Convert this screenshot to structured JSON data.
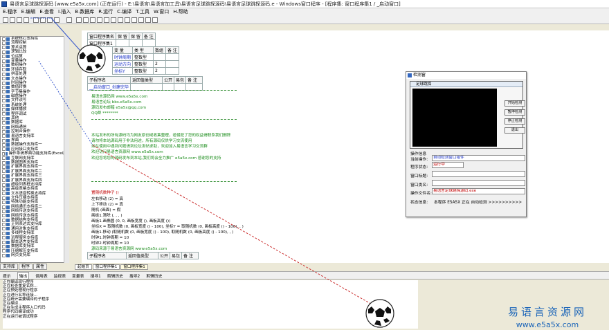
{
  "window": {
    "title": "易语言足球跳探源码 [www.e5a5x.com] (正在运行) - E:\\易语言\\易语言加工具\\易语言足球跳探源码\\易语言足球跳探源码.e - Windows窗口程序 - [程序集: 窗口程序集1 / _启动窗口]"
  },
  "menu": [
    "E.程序",
    "E.编辑",
    "E.查看",
    "I.插入",
    "B.数据库",
    "R.运行",
    "C.编译",
    "T.工具",
    "W.窗口",
    "H.帮助"
  ],
  "tree": {
    "items": [
      "系统核心支持库",
      "流程控制",
      "算术运算",
      "逻辑比较",
      "位运算",
      "变量操作",
      "数组操作",
      "环境存取",
      "拼音处理",
      "文本操作",
      "时间操作",
      "数值转换",
      "字节集操作",
      "磁盘操作",
      "文件读写",
      "系统处理",
      "媒体播放",
      "程序调试",
      "其他",
      "数据库",
      "网络通信",
      "控制台操作",
      "易语言支持库",
      "界面",
      "数据操作支持库一",
      "应用接口支持库",
      "操作系统界面功能支持库(Excel版)",
      "互联网支持库",
      "数据图表支持库",
      "扩展界面支持库一",
      "扩展界面支持库二",
      "扩展界面支持库三",
      "扩展界面支持库四",
      "超级列表框支持库",
      "高级表格支持库",
      "文本语音转换支持库",
      "文件压缩支持库",
      "特殊功能支持库",
      "网络通讯支持库二",
      "网络传送支持库",
      "网络传送支持库",
      "数据结构支持库",
      "正则表达式支持库",
      "通用对象支持库",
      "多线程支持库",
      "远程服务支持库",
      "脚本语言支持库",
      "数据库支持库",
      "压缩解压支持库",
      "网页支持库"
    ],
    "tabs": [
      "支持库",
      "程序",
      "属性"
    ]
  },
  "editor": {
    "tab_bar": [
      "起始页",
      "窗口程序集1",
      "窗口程序集1"
    ],
    "assembly_header": [
      "窗口程序集名",
      "保 留",
      "保 留",
      "备 注"
    ],
    "assembly_name": "窗口程序集1",
    "var_header": [
      "变 量",
      "类 型",
      "数组",
      "备 注"
    ],
    "vars": [
      [
        "时钟周期",
        "整数型",
        ""
      ],
      [
        "运动方向",
        "整数型",
        "2"
      ],
      [
        "坐标Y",
        "整数型",
        "2"
      ]
    ],
    "sub_header": [
      "子程序名",
      "返回值类型",
      "公开",
      "易包",
      "备 注"
    ],
    "sub_name": "__启动窗口_创建完毕",
    "comments": [
      "易语言源码网     www.e5a5x.com",
      "易语言论坛     bbs.e5a5x.com",
      "源码发布邮箱    e5a5x@qq.com",
      "QQ群     ********",
      "本站发布的所有源码均为网友原创或收集整理，若侵犯了您的权益请联系我们删除",
      "请勿将本站源码用于非法用途，所有源码仅供学习交流使用",
      "如在使用中遇到问题请到论坛发帖求助，欢迎加入易语言学习交流群",
      "欢迎访问易语言资源网 www.e5a5x.com",
      "欢迎您将您的源码发布到本站,我们将会全力推广 e5a5x.com 感谢您的支持"
    ],
    "code": [
      "置随机数种子 ()",
      "左右移动 (2) = 真",
      "上下移动 (2) = 真",
      "随机 (画面) = 假",
      "画板1.清除 (, , , )",
      "画板1.画椭圆 (0, 0, 画板宽度 (), 画板高度 ())",
      "坐标X = 取随机数 (0, 画板宽度 () - 100), 坐标Y = 取随机数 (0, 画板高度 () - 100), , )",
      "画板1.移动 (取随机数 (0, 画板宽度 () - 100), 取随机数 (0, 画板高度 () - 100), , )",
      "时钟1.时钟周期 = 10",
      "时钟2.时钟周期 = 10",
      "源码来源于易语言资源网 www.e5a5x.com"
    ],
    "sub2_header": [
      "子程序名",
      "返回值类型",
      "公开",
      "易包",
      "备 注"
    ]
  },
  "bottom_tabs": [
    "起始页",
    "窗口程序集1",
    "窗口程序集1"
  ],
  "output": {
    "tabs": [
      "提示",
      "输出",
      "调用表",
      "监视表",
      "变量表",
      "搜寻1",
      "剪辑历史",
      "搜寻2",
      "剪辑历史"
    ],
    "lines": [
      "正在编译现行程序",
      "正在检查重复名称...",
      "正在预处理现行程序",
      "正在进行名称连接...",
      "正在统计需要编译的子程序",
      "正在编译...",
      "正在生成主程序入口代码",
      "程序代码编译成功",
      "正在运行被调试程序"
    ]
  },
  "dialog": {
    "caption": "检测窗",
    "inner_caption": "足球跳探",
    "buttons": [
      "开始检测",
      "暂停检测",
      "停止检测",
      "退出"
    ],
    "fields": [
      {
        "label": "操作信息",
        "value": ""
      },
      {
        "label": "当前操作:",
        "value": "自动检测窗口组件"
      },
      {
        "label": "程序状态:",
        "value": "运行中"
      },
      {
        "label": "窗口标题:",
        "value": ""
      },
      {
        "label": "窗口类名:",
        "value": ""
      },
      {
        "label": "操作文件名:",
        "value": "易语言足球跳探源码.exe"
      }
    ],
    "status_label": "状态信息:",
    "status_value": "本程序 E5A5X 正在 自动检测 >>>>>>>>>>"
  },
  "brand": {
    "cn": "易语言资源网",
    "url": "www.e5a5x.com"
  }
}
